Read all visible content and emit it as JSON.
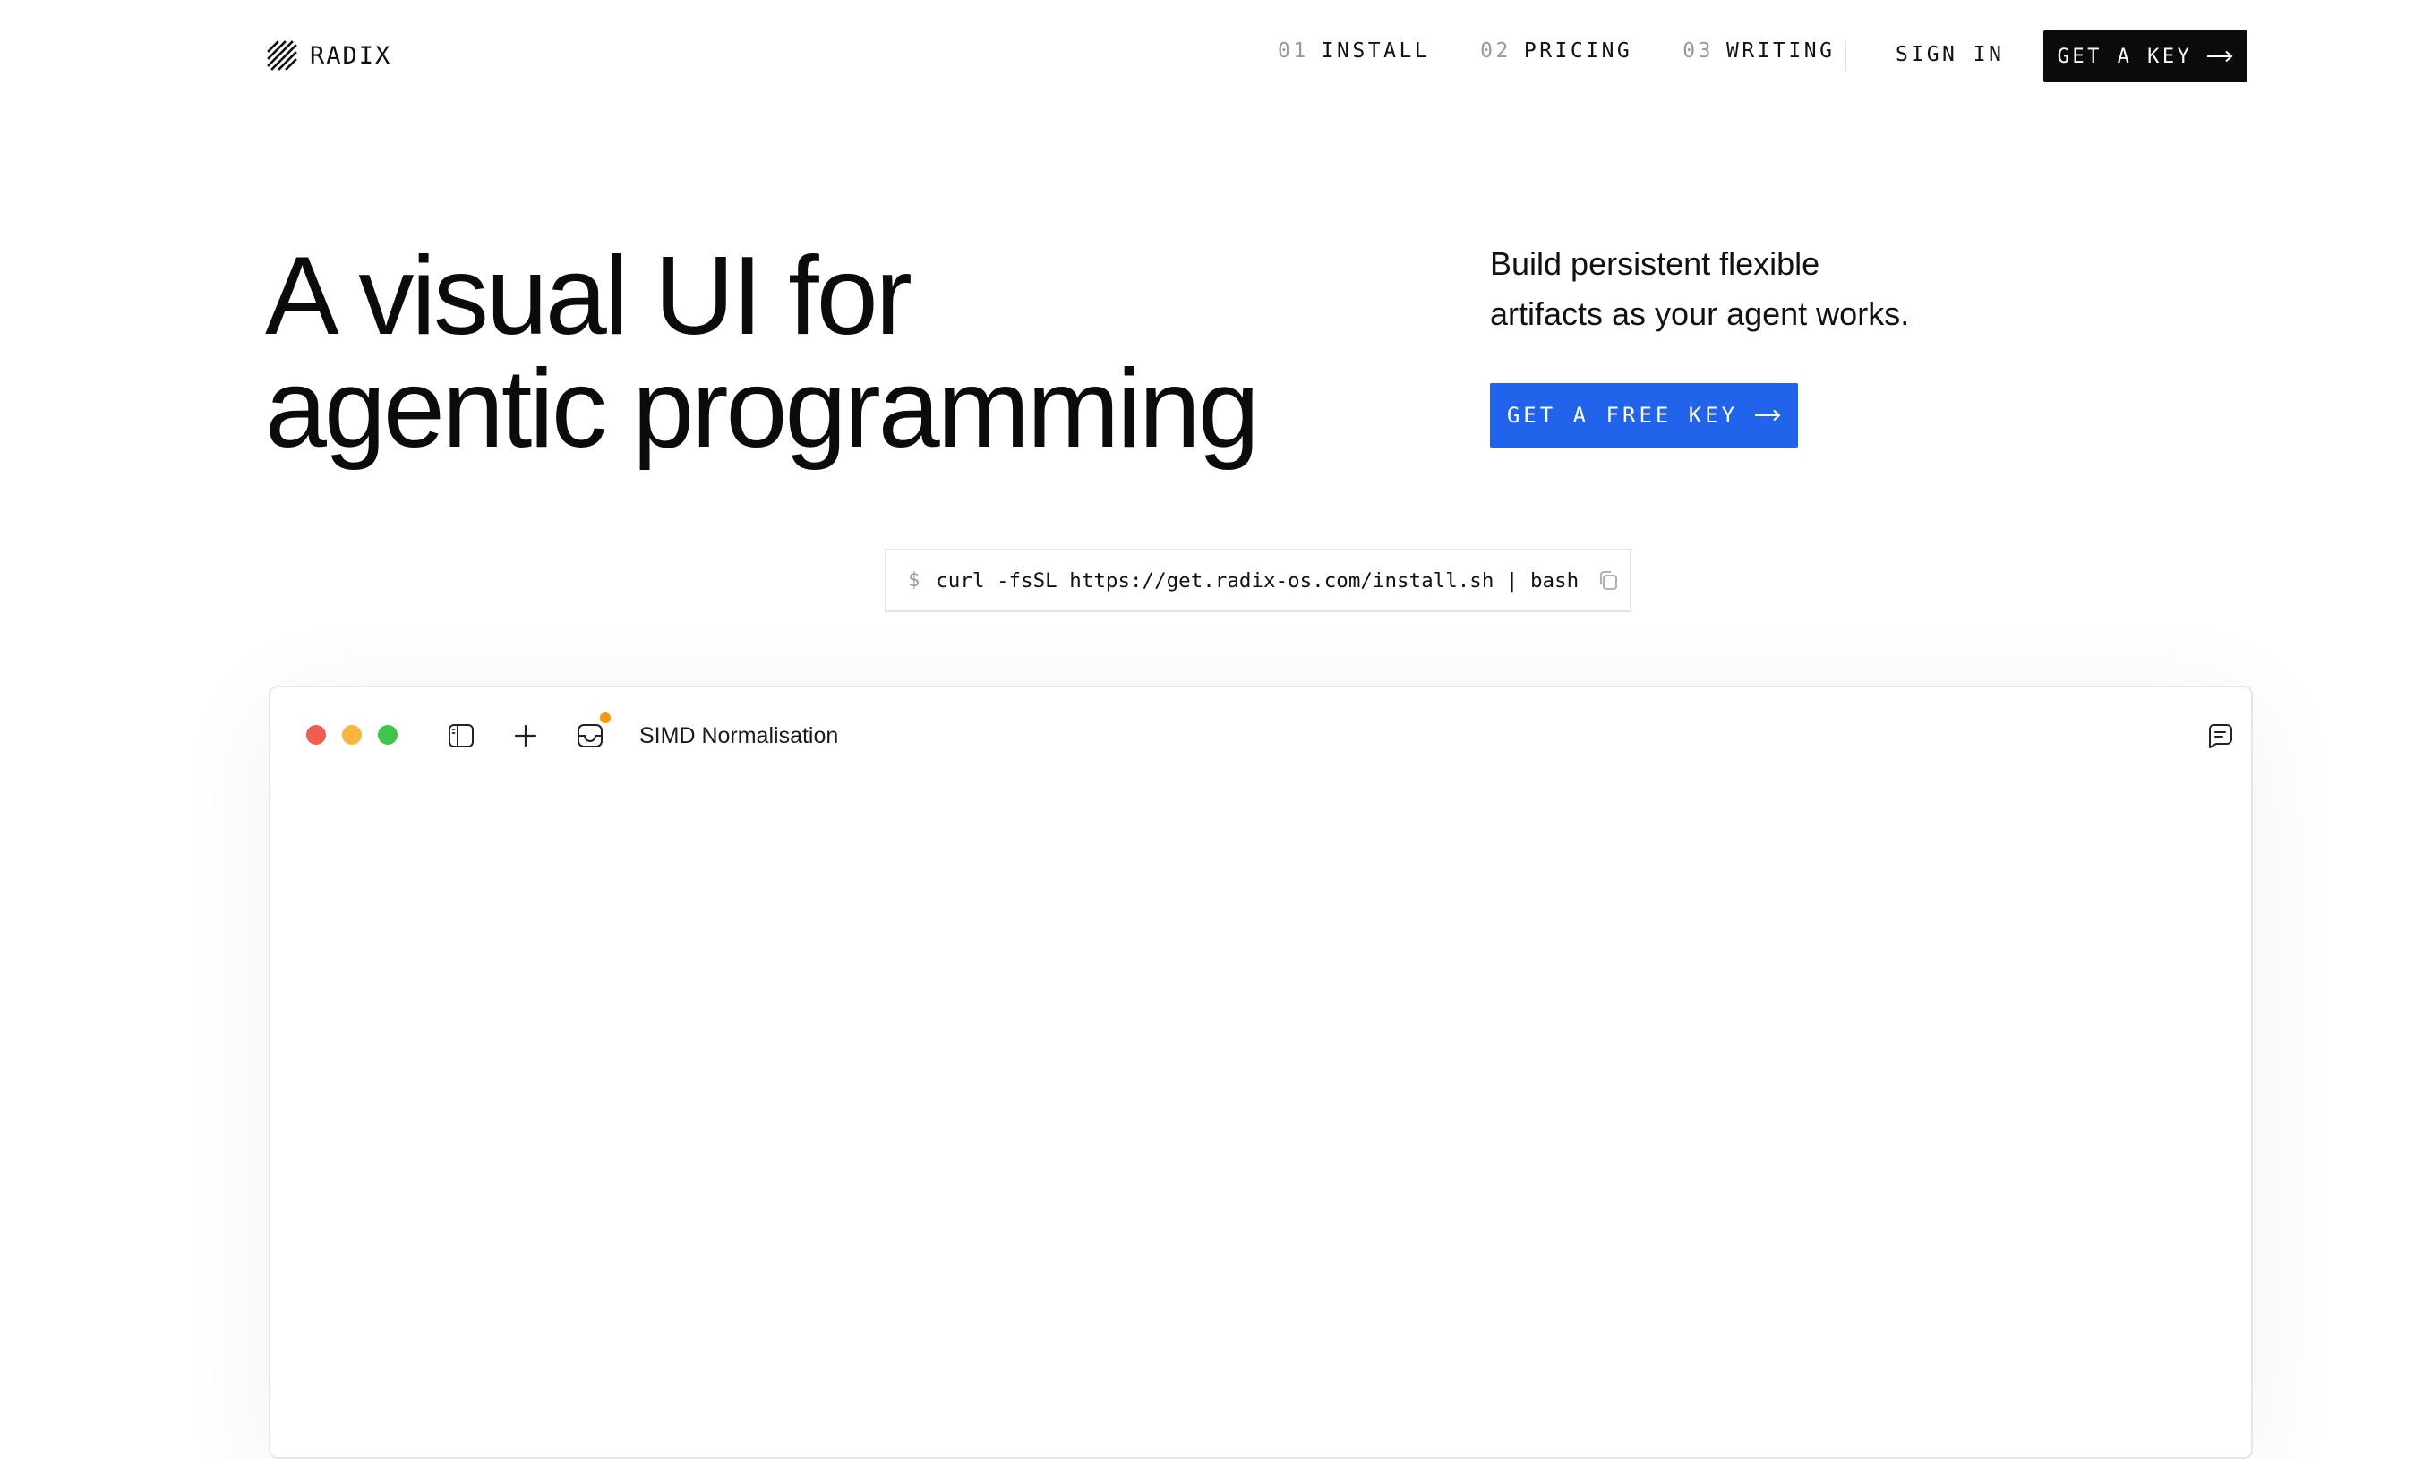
{
  "brand": {
    "name": "RADIX",
    "logo_icon": "diagonal-stripes-logo"
  },
  "nav": {
    "links": [
      {
        "num": "01",
        "label": "INSTALL"
      },
      {
        "num": "02",
        "label": "PRICING"
      },
      {
        "num": "03",
        "label": "WRITING"
      }
    ],
    "sign_in": "SIGN IN",
    "cta": "GET A KEY"
  },
  "hero": {
    "headline_line1": "A visual UI for",
    "headline_line2": "agentic programming",
    "subhead_line1": "Build persistent flexible",
    "subhead_line2": "artifacts as your agent works.",
    "cta": "GET A FREE KEY"
  },
  "install": {
    "prompt": "$",
    "command": "curl -fsSL https://get.radix-os.com/install.sh | bash",
    "copy_icon": "copy-icon"
  },
  "app_window": {
    "title": "SIMD Normalisation",
    "icons": [
      "sidebar-toggle-icon",
      "plus-icon",
      "inbox-icon",
      "chat-icon"
    ],
    "notification": true
  },
  "colors": {
    "primary_blue": "#2163ea",
    "black": "#0b0b0b",
    "traffic_red": "#f25d52",
    "traffic_yellow": "#f6b73c",
    "traffic_green": "#3ec64a",
    "notification_orange": "#f59a0b"
  }
}
